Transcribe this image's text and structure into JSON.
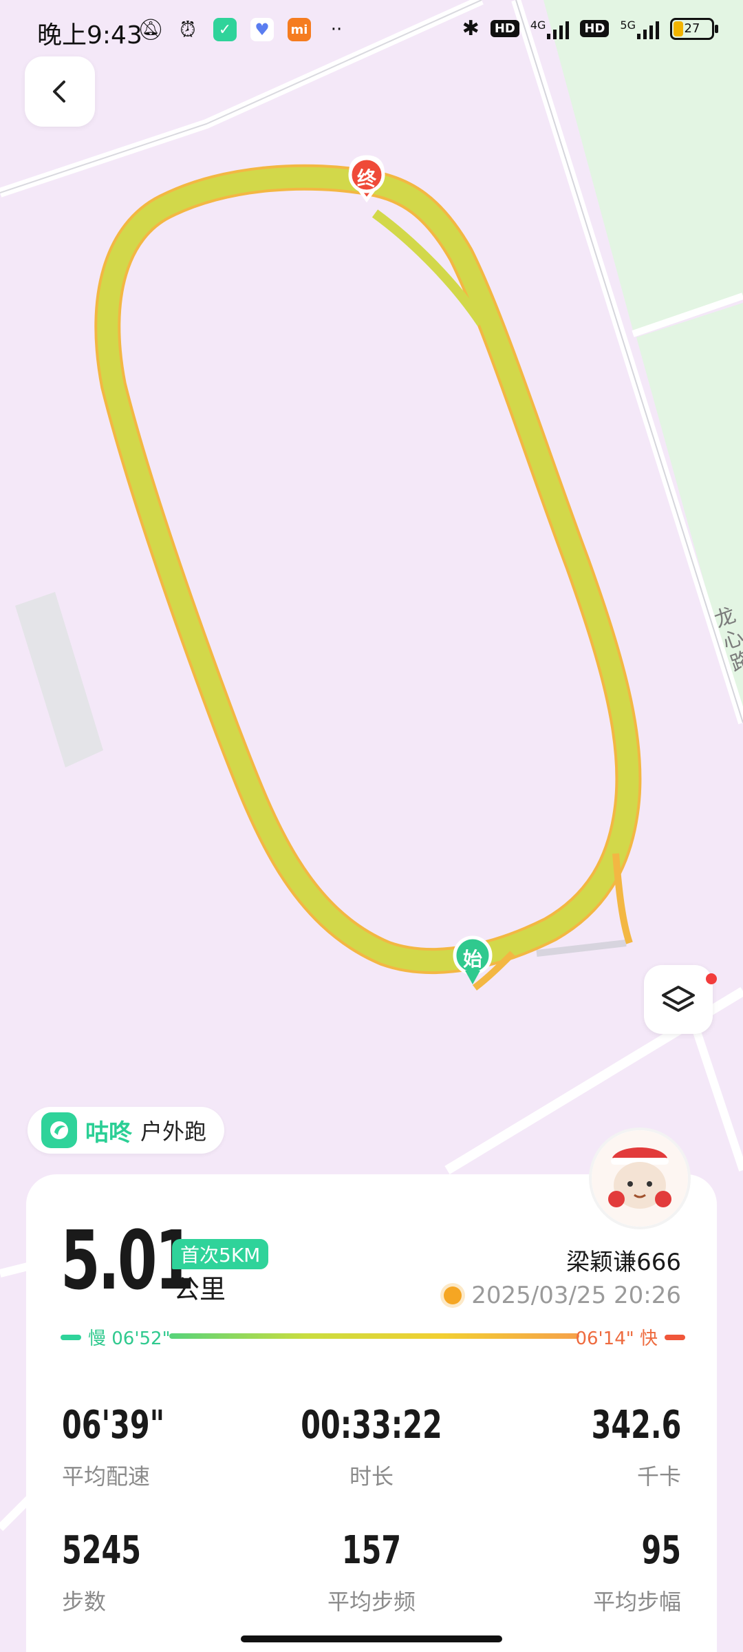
{
  "status_bar": {
    "time": "晚上9:43",
    "icons": [
      "bell-off-icon",
      "alarm-icon",
      "gudong-app-icon",
      "health-app-icon",
      "mi-app-icon",
      "more-dots-icon"
    ],
    "right": {
      "bluetooth": "bluetooth-icon",
      "hd1": "HD",
      "net1": "4G",
      "hd2": "HD",
      "net2": "5G",
      "battery": "27"
    }
  },
  "map": {
    "road_label": "龙心路",
    "start_marker": "始",
    "end_marker": "终",
    "route_color": "#d2d84a",
    "route_edge_color": "#f5b63a"
  },
  "brand": {
    "name": "咕咚",
    "activity": "户外跑",
    "color": "#2fd39a"
  },
  "summary": {
    "distance": "5.01",
    "badge": "首次5KM",
    "unit": "公里",
    "user": "梁颖谦666",
    "datetime": "2025/03/25 20:26"
  },
  "pace_scale": {
    "slow_label": "慢 06'52\"",
    "fast_label": "06'14\" 快"
  },
  "stats": [
    {
      "value": "06'39\"",
      "label": "平均配速"
    },
    {
      "value": "00:33:22",
      "label": "时长"
    },
    {
      "value": "342.6",
      "label": "千卡"
    },
    {
      "value": "5245",
      "label": "步数"
    },
    {
      "value": "157",
      "label": "平均步频"
    },
    {
      "value": "95",
      "label": "平均步幅"
    }
  ]
}
